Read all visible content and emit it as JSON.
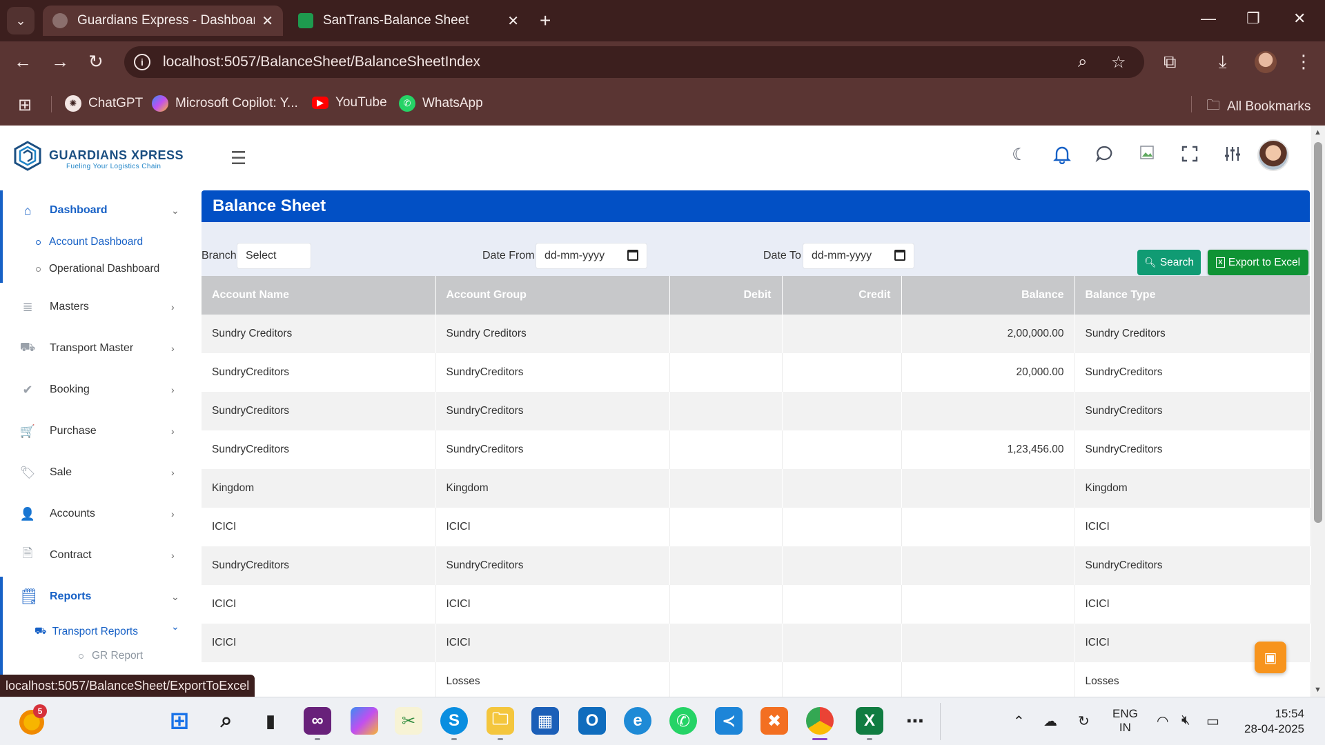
{
  "browser": {
    "tabs": [
      {
        "title": "Guardians Express - Dashboard",
        "active": true
      },
      {
        "title": "SanTrans-Balance Sheet",
        "active": false
      }
    ],
    "url": "localhost:5057/BalanceSheet/BalanceSheetIndex",
    "bookmarks": [
      "ChatGPT",
      "Microsoft Copilot: Y...",
      "YouTube",
      "WhatsApp"
    ],
    "all_bookmarks": "All Bookmarks",
    "status_url": "localhost:5057/BalanceSheet/ExportToExcel"
  },
  "app": {
    "logo_title": "GUARDIANS XPRESS",
    "logo_tagline": "Fueling Your Logistics Chain"
  },
  "sidebar": {
    "dashboard": "Dashboard",
    "dashboard_sub": [
      "Account Dashboard",
      "Operational Dashboard"
    ],
    "items": [
      "Masters",
      "Transport Master",
      "Booking",
      "Purchase",
      "Sale",
      "Accounts",
      "Contract"
    ],
    "reports": "Reports",
    "transport_reports": "Transport Reports",
    "gr_report": "GR Report"
  },
  "page": {
    "title": "Balance Sheet",
    "filters": {
      "branch_label": "Branch",
      "branch_value": "Select",
      "date_from_label": "Date From",
      "date_from_value": "dd-mm-yyyy",
      "date_to_label": "Date To",
      "date_to_value": "dd-mm-yyyy"
    },
    "search_label": "Search",
    "export_label": "Export to Excel"
  },
  "table": {
    "columns": [
      "Account Name",
      "Account Group",
      "Debit",
      "Credit",
      "Balance",
      "Balance Type"
    ],
    "rows": [
      [
        "Sundry Creditors",
        "Sundry Creditors",
        "",
        "",
        "2,00,000.00",
        "Sundry Creditors"
      ],
      [
        "SundryCreditors",
        "SundryCreditors",
        "",
        "",
        "20,000.00",
        "SundryCreditors"
      ],
      [
        "SundryCreditors",
        "SundryCreditors",
        "",
        "",
        "",
        "SundryCreditors"
      ],
      [
        "SundryCreditors",
        "SundryCreditors",
        "",
        "",
        "1,23,456.00",
        "SundryCreditors"
      ],
      [
        "Kingdom",
        "Kingdom",
        "",
        "",
        "",
        "Kingdom"
      ],
      [
        "ICICI",
        "ICICI",
        "",
        "",
        "",
        "ICICI"
      ],
      [
        "SundryCreditors",
        "SundryCreditors",
        "",
        "",
        "",
        "SundryCreditors"
      ],
      [
        "ICICI",
        "ICICI",
        "",
        "",
        "",
        "ICICI"
      ],
      [
        "ICICI",
        "ICICI",
        "",
        "",
        "",
        "ICICI"
      ],
      [
        "",
        "Losses",
        "",
        "",
        "",
        "Losses"
      ]
    ]
  },
  "taskbar": {
    "weather_badge": "5",
    "lang_line1": "ENG",
    "lang_line2": "IN",
    "time": "15:54",
    "date": "28-04-2025"
  },
  "colors": {
    "page_header": "#0250c5",
    "search_button": "#109b73",
    "export_button": "#0f9334",
    "sidebar_active": "#1761c6",
    "browser_frame": "#3c1f1e"
  }
}
